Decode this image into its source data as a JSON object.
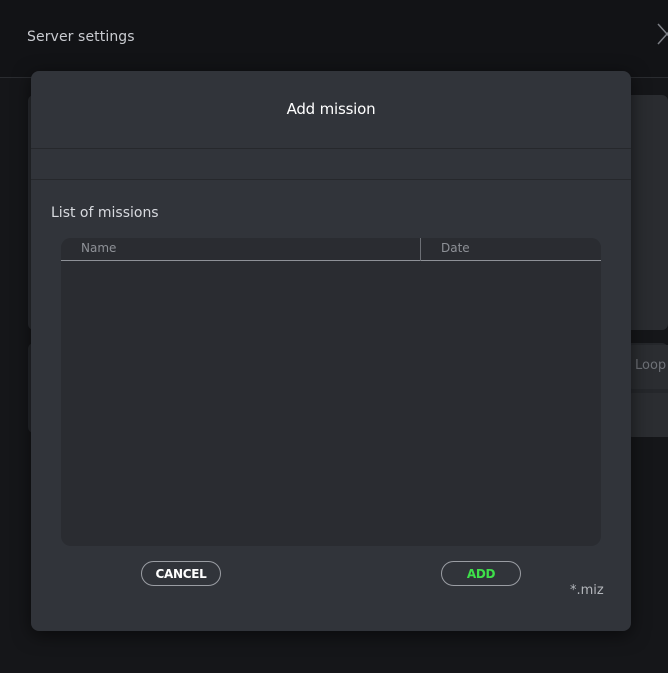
{
  "background": {
    "window_title": "Server settings",
    "loop_label": "Loop"
  },
  "modal": {
    "title": "Add mission",
    "list_label": "List of missions",
    "table": {
      "columns": [
        "Name",
        "Date"
      ],
      "rows": []
    },
    "cancel_label": "CANCEL",
    "add_label": "ADD",
    "file_filter": "*.miz"
  },
  "colors": {
    "accent_green": "#3ee04a",
    "modal_bg": "#31343a",
    "page_bg": "#151619"
  },
  "icons": {
    "close": "close-icon"
  }
}
